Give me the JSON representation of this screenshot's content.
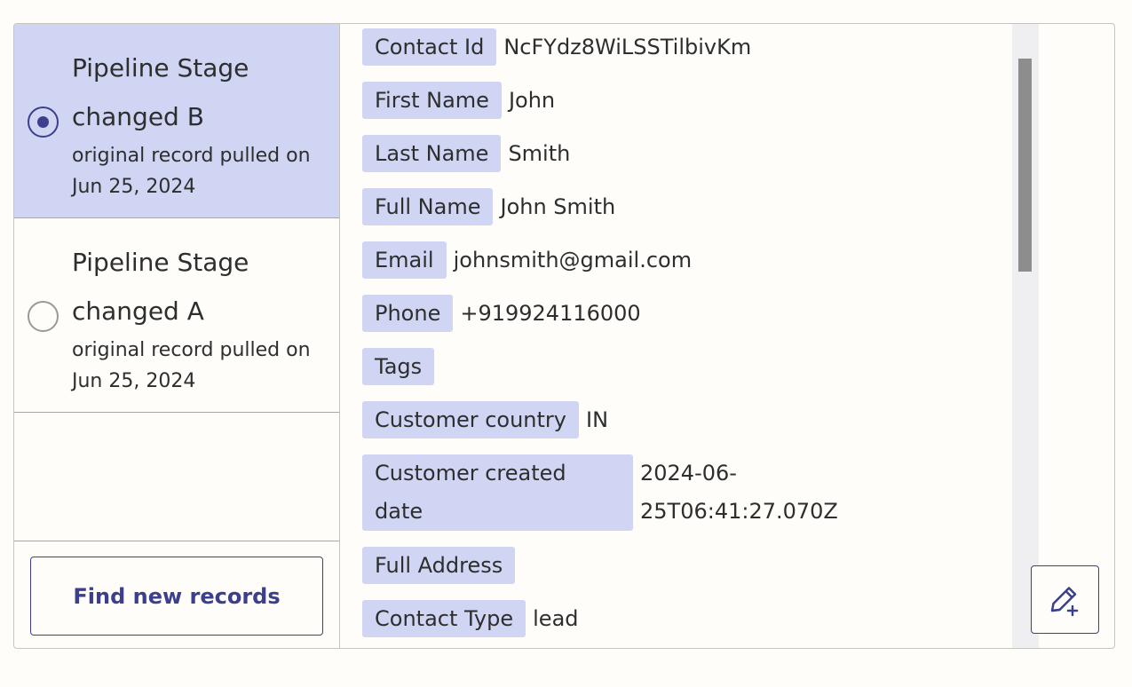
{
  "records": [
    {
      "title": "Pipeline Stage changed B",
      "meta": "original record pulled on Jun 25, 2024",
      "selected": true
    },
    {
      "title": "Pipeline Stage changed A",
      "meta": "original record pulled on Jun 25, 2024",
      "selected": false
    }
  ],
  "find_button_label": "Find new records",
  "fields": [
    {
      "label": "Contact Id",
      "value": "NcFYdz8WiLSSTilbivKm"
    },
    {
      "label": "First Name",
      "value": "John"
    },
    {
      "label": "Last Name",
      "value": "Smith"
    },
    {
      "label": "Full Name",
      "value": "John Smith"
    },
    {
      "label": "Email",
      "value": "johnsmith@gmail.com"
    },
    {
      "label": "Phone",
      "value": "+919924116000"
    },
    {
      "label": "Tags",
      "value": ""
    },
    {
      "label": "Customer country",
      "value": "IN"
    },
    {
      "label": "Customer created date",
      "value": "2024-06-25T06:41:27.070Z"
    },
    {
      "label": "Full Address",
      "value": ""
    },
    {
      "label": "Contact Type",
      "value": "lead"
    }
  ],
  "icons": {
    "radio_selected": "radio-selected-icon",
    "radio_unselected": "radio-unselected-icon",
    "edit": "pencil-plus-icon"
  },
  "colors": {
    "accent": "#3b3f8e",
    "selected_bg": "#d0d5f3",
    "label_bg": "#d0d5f3",
    "page_bg": "#fffdf9"
  }
}
